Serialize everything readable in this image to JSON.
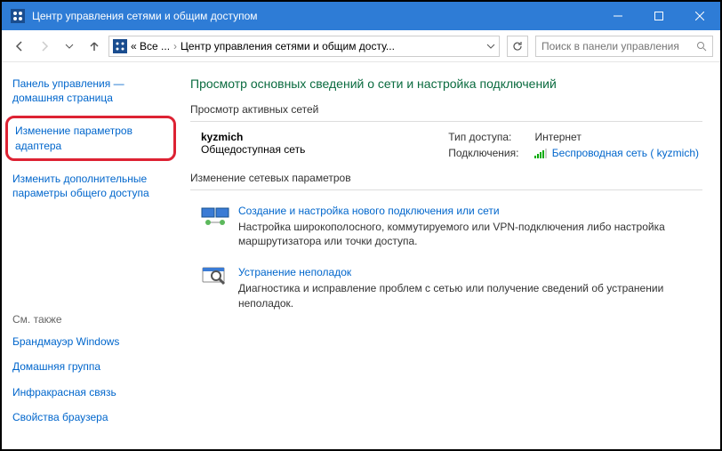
{
  "window": {
    "title": "Центр управления сетями и общим доступом"
  },
  "nav": {
    "bc1": "« Все ...",
    "bc2": "Центр управления сетями и общим досту...",
    "search_placeholder": "Поиск в панели управления"
  },
  "sidebar": {
    "home": "Панель управления — домашняя страница",
    "adapter": "Изменение параметров адаптера",
    "sharing": "Изменить дополнительные параметры общего доступа",
    "seealso": "См. также",
    "firewall": "Брандмауэр Windows",
    "homegroup": "Домашняя группа",
    "irda": "Инфракрасная связь",
    "inetopt": "Свойства браузера"
  },
  "main": {
    "title": "Просмотр основных сведений о сети и настройка подключений",
    "active_heading": "Просмотр активных сетей",
    "net_name": "kyzmich",
    "net_type": "Общедоступная сеть",
    "access_lbl": "Тип доступа:",
    "access_val": "Интернет",
    "conn_lbl": "Подключения:",
    "conn_val": "Беспроводная сеть ( kyzmich)",
    "change_heading": "Изменение сетевых параметров",
    "opt1_title": "Создание и настройка нового подключения или сети",
    "opt1_desc": "Настройка широкополосного, коммутируемого или VPN-подключения либо настройка маршрутизатора или точки доступа.",
    "opt2_title": "Устранение неполадок",
    "opt2_desc": "Диагностика и исправление проблем с сетью или получение сведений об устранении неполадок."
  }
}
